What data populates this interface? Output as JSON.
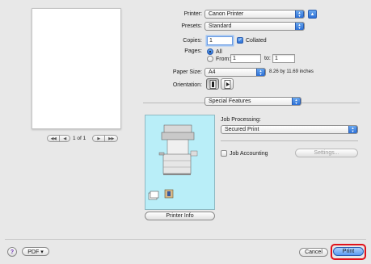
{
  "printer": {
    "label": "Printer:",
    "value": "Canon Printer"
  },
  "presets": {
    "label": "Presets:",
    "value": "Standard"
  },
  "copies": {
    "label": "Copies:",
    "value": "1",
    "collated_label": "Collated",
    "collated_checked": true
  },
  "pages": {
    "label": "Pages:",
    "all_label": "All",
    "from_label": "From:",
    "from_value": "1",
    "to_label": "to:",
    "to_value": "1",
    "selected": "All"
  },
  "paper_size": {
    "label": "Paper Size:",
    "value": "A4",
    "dimensions": "8.26 by 11.69 inches"
  },
  "orientation": {
    "label": "Orientation:",
    "selected": "portrait"
  },
  "preview": {
    "page_indicator": "1 of 1",
    "first_glyph": "◀◀",
    "prev_glyph": "◀",
    "next_glyph": "▶",
    "last_glyph": "▶▶"
  },
  "panel_select": {
    "value": "Special Features"
  },
  "job_processing": {
    "label": "Job Processing:",
    "value": "Secured Print"
  },
  "job_accounting": {
    "label": "Job Accounting",
    "checked": false,
    "settings_label": "Settings..."
  },
  "printer_info_label": "Printer Info",
  "footer": {
    "help_glyph": "?",
    "pdf_label": "PDF ▾",
    "cancel_label": "Cancel",
    "print_label": "Print"
  },
  "colors": {
    "accent": "#2b6fd6",
    "illustration_bg": "#b9eef8",
    "highlight": "#e0121b"
  }
}
